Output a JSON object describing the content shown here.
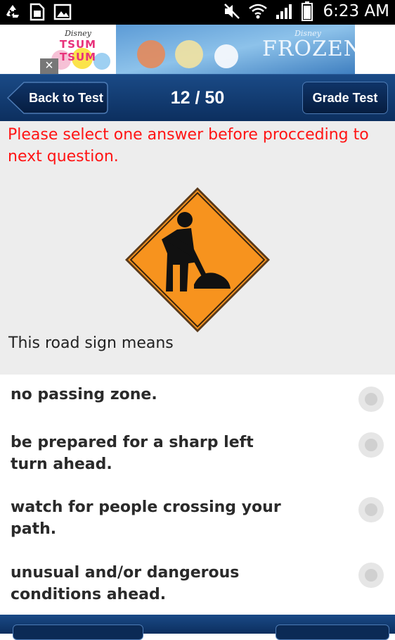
{
  "status_bar": {
    "time": "6:23 AM",
    "left_icons": [
      "recycle-icon",
      "sim-card-icon",
      "image-icon"
    ],
    "right_icons": [
      "mute-icon",
      "wifi-icon",
      "signal-icon",
      "battery-icon"
    ]
  },
  "ad": {
    "brand_left": "Disney",
    "game_title": "TSUM TSUM",
    "brand_right": "Disney",
    "movie_title": "FROZEN",
    "close_label": "×"
  },
  "nav": {
    "back_label": "Back to Test",
    "counter": "12 / 50",
    "grade_label": "Grade Test"
  },
  "question": {
    "warning": "Please select one answer before procceding to next question.",
    "text": "This road sign means",
    "sign_icon": "road-work-sign-icon",
    "sign_color": "#f7931e"
  },
  "answers": [
    {
      "text": "no passing zone.",
      "selected": false
    },
    {
      "text": "be prepared for a sharp left turn ahead.",
      "selected": false
    },
    {
      "text": "watch for people crossing your path.",
      "selected": false
    },
    {
      "text": "unusual and/or dangerous conditions ahead.",
      "selected": false
    }
  ],
  "colors": {
    "nav_bar": "#12417a",
    "warning_text": "#ff1414",
    "question_bg": "#ededed"
  }
}
